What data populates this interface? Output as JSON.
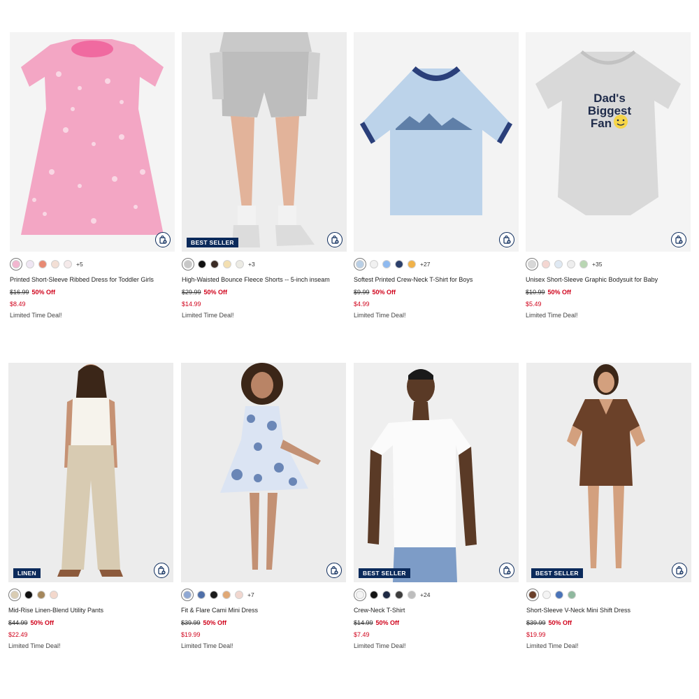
{
  "products": [
    {
      "name": "Printed Short-Sleeve Ribbed Dress for Toddler Girls",
      "badge": "",
      "swatches": [
        "#f2b6cf",
        "#efe6f3",
        "#e88a73",
        "#f3dfd5",
        "#f5eaea"
      ],
      "more": "+5",
      "original_price": "$16.99",
      "discount": "50% Off",
      "sale_price": "$8.49",
      "deal": "Limited Time Deal!",
      "image": "pink-floral-toddler-dress"
    },
    {
      "name": "High-Waisted Bounce Fleece Shorts -- 5-inch inseam",
      "badge": "BEST SELLER",
      "swatches": [
        "#c7c7c7",
        "#111111",
        "#3a2b24",
        "#f3dfb1",
        "#ecebe4"
      ],
      "more": "+3",
      "original_price": "$29.99",
      "discount": "50% Off",
      "sale_price": "$14.99",
      "deal": "Limited Time Deal!",
      "image": "grey-fleece-shorts"
    },
    {
      "name": "Softest Printed Crew-Neck T-Shirt for Boys",
      "badge": "",
      "swatches": [
        "#b9cfe6",
        "#f1f1f1",
        "#8fbaf0",
        "#2b3f6a",
        "#f0b24a"
      ],
      "more": "+27",
      "original_price": "$9.99",
      "discount": "50% Off",
      "sale_price": "$4.99",
      "deal": "Limited Time Deal!",
      "image": "light-blue-ringer-tee"
    },
    {
      "name": "Unisex Short-Sleeve Graphic Bodysuit for Baby",
      "badge": "",
      "swatches": [
        "#d8d8d8",
        "#f4d7d2",
        "#dfe9f3",
        "#eeeeee",
        "#b9d6b3"
      ],
      "more": "+35",
      "original_price": "$10.99",
      "discount": "50% Off",
      "sale_price": "$5.49",
      "deal": "Limited Time Deal!",
      "image": "grey-graphic-bodysuit",
      "graphic_text": [
        "Dad's",
        "Biggest",
        "Fan"
      ]
    },
    {
      "name": "Mid-Rise Linen-Blend Utility Pants",
      "badge": "LINEN",
      "swatches": [
        "#d9ccb3",
        "#111111",
        "#a4875c",
        "#f3d8cc"
      ],
      "more": "",
      "original_price": "$44.99",
      "discount": "50% Off",
      "sale_price": "$22.49",
      "deal": "Limited Time Deal!",
      "image": "linen-utility-pants"
    },
    {
      "name": "Fit & Flare Cami Mini Dress",
      "badge": "",
      "swatches": [
        "#8fa8d3",
        "#4f6fa8",
        "#1b1b1b",
        "#e0a875",
        "#f1d7cf"
      ],
      "more": "+7",
      "original_price": "$39.99",
      "discount": "50% Off",
      "sale_price": "$19.99",
      "deal": "Limited Time Deal!",
      "image": "blue-floral-cami-dress"
    },
    {
      "name": "Crew-Neck T-Shirt",
      "badge": "BEST SELLER",
      "swatches": [
        "#f4f4f4",
        "#141414",
        "#1f2a44",
        "#3d3d3d",
        "#bdbdbd"
      ],
      "more": "+24",
      "original_price": "$14.99",
      "discount": "50% Off",
      "sale_price": "$7.49",
      "deal": "Limited Time Deal!",
      "image": "white-crew-tee"
    },
    {
      "name": "Short-Sleeve V-Neck Mini Shift Dress",
      "badge": "BEST SELLER",
      "swatches": [
        "#6a3f2a",
        "#f4f4f4",
        "#4a73b8",
        "#8fb89e"
      ],
      "more": "",
      "original_price": "$39.99",
      "discount": "50% Off",
      "sale_price": "$19.99",
      "deal": "Limited Time Deal!",
      "image": "brown-vneck-shift-dress"
    }
  ],
  "icons": {
    "bag": "add-to-bag-icon"
  },
  "colors": {
    "badge_bg": "#0b2a5b",
    "sale": "#d0021b"
  }
}
